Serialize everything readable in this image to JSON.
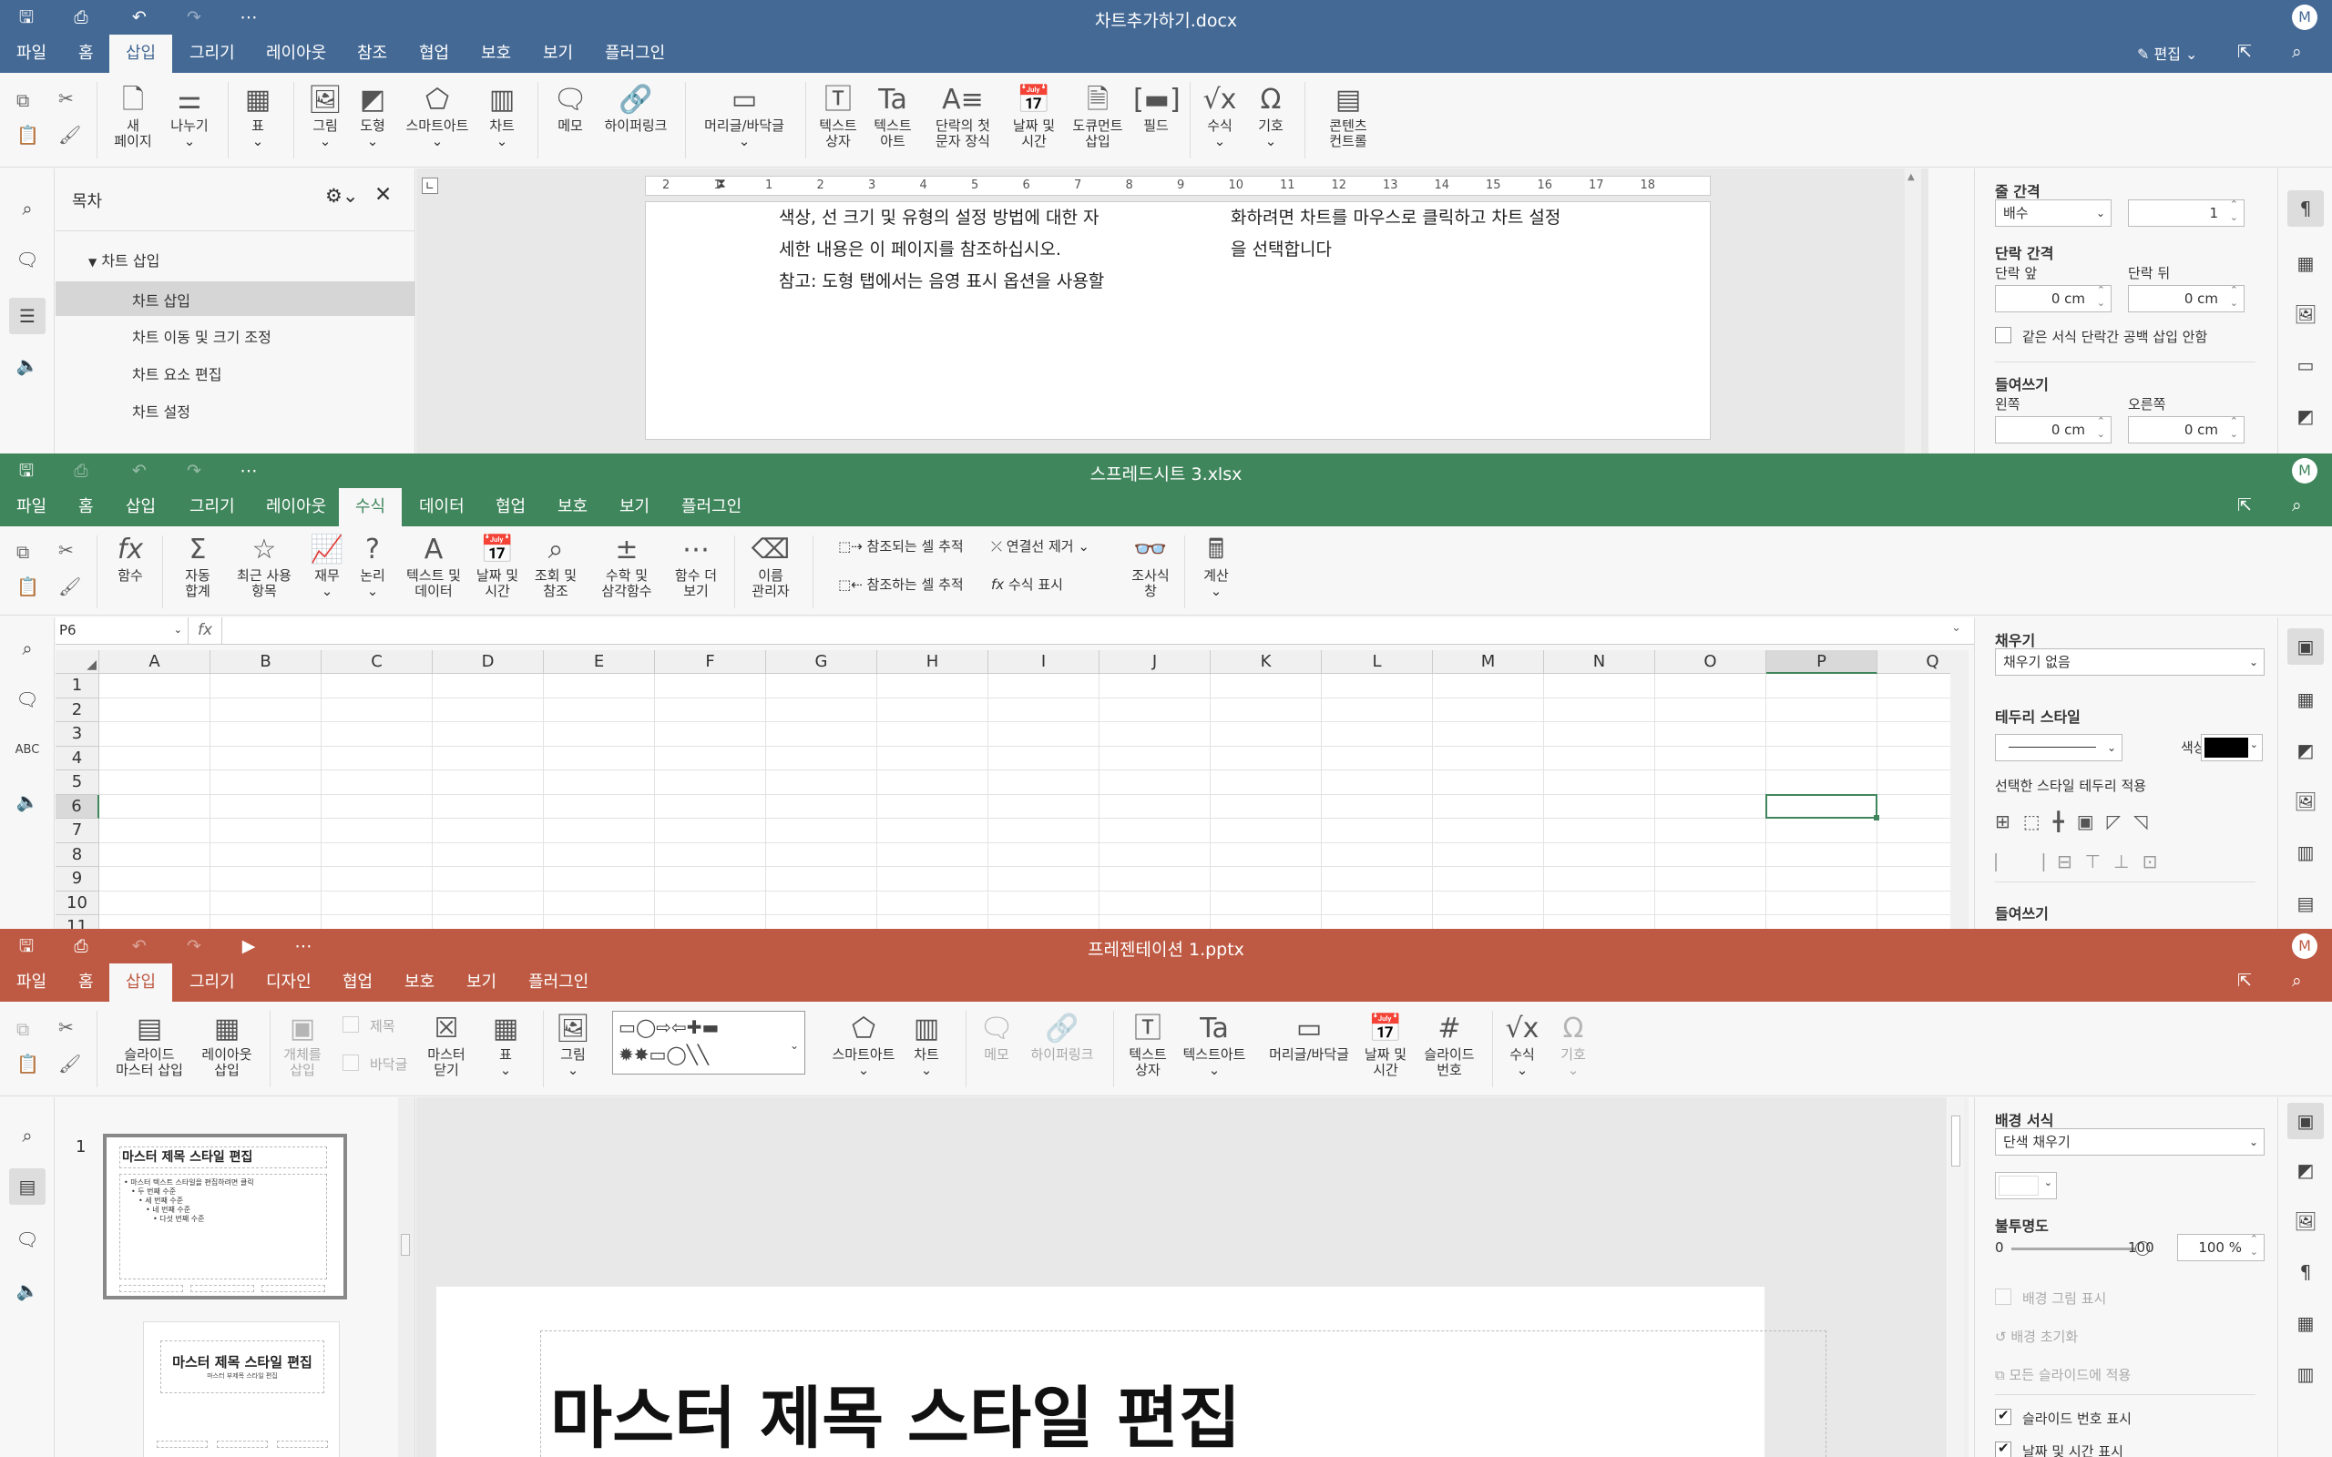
{
  "doc": {
    "title": "차트추가하기.docx",
    "tabs": [
      "파일",
      "홈",
      "삽입",
      "그리기",
      "레이아웃",
      "참조",
      "협업",
      "보호",
      "보기",
      "플러그인"
    ],
    "active_tab": "삽입",
    "edit_label": "편집",
    "ribbon": {
      "new_page": "새\n페이지",
      "break": "나누기",
      "table": "표",
      "image": "그림",
      "shape": "도형",
      "smartart": "스마트아트",
      "chart": "차트",
      "comment": "메모",
      "hyperlink": "하이퍼링크",
      "header_footer": "머리글/바닥글",
      "textbox": "텍스트\n상자",
      "textart": "텍스트\n아트",
      "dropcap": "단락의 첫\n문자 장식",
      "datetime": "날짜 및\n시간",
      "docpart": "도큐먼트\n삽입",
      "field": "필드",
      "equation": "수식",
      "symbol": "기호",
      "content_controls": "콘텐츠\n컨트롤"
    },
    "toc": {
      "title": "목차",
      "items": [
        "차트 삽입",
        "차트 삽입",
        "차트 이동 및 크기 조정",
        "차트 요소 편집",
        "차트 설정"
      ]
    },
    "ruler": [
      "2",
      "1",
      "1",
      "2",
      "3",
      "4",
      "5",
      "6",
      "7",
      "8",
      "9",
      "10",
      "11",
      "12",
      "13",
      "14",
      "15",
      "16",
      "17",
      "18"
    ],
    "text_left": [
      "색상, 선 크기 및 유형의 설정 방법에 대한 자",
      "세한 내용은 이 페이지를 참조하십시오.",
      "참고: 도형 탭에서는 음영 표시 옵션을 사용할"
    ],
    "text_right": [
      "화하려면 차트를 마우스로 클릭하고 차트 설정",
      "을 선택합니다"
    ],
    "props": {
      "line_spacing": "줄 간격",
      "line_mode": "배수",
      "line_val": "1",
      "para_spacing": "단락 간격",
      "before": "단락 앞",
      "after": "단락 뒤",
      "before_val": "0 cm",
      "after_val": "0 cm",
      "no_space": "같은 서식 단락간 공백 삽입 안함",
      "indent": "들여쓰기",
      "left": "왼쪽",
      "right": "오른쪽",
      "left_val": "0 cm",
      "right_val": "0 cm"
    }
  },
  "sheet": {
    "title": "스프레드시트 3.xlsx",
    "tabs": [
      "파일",
      "홈",
      "삽입",
      "그리기",
      "레이아웃",
      "수식",
      "데이터",
      "협업",
      "보호",
      "보기",
      "플러그인"
    ],
    "active_tab": "수식",
    "ribbon": {
      "function": "함수",
      "autosum": "자동\n합계",
      "recent": "최근 사용\n항목",
      "financial": "재무",
      "logical": "논리",
      "text_data": "텍스트 및\n데이터",
      "datetime": "날짜 및\n시간",
      "lookup": "조회 및\n참조",
      "math": "수학 및\n삼각함수",
      "more": "함수 더\n보기",
      "names": "이름\n관리자",
      "trace_prec": "참조되는 셀 추적",
      "trace_dep": "참조하는 셀 추적",
      "remove_arrows": "연결선 제거",
      "show_formula": "수식 표시",
      "watch": "조사식\n창",
      "calc": "계산"
    },
    "name_box": "P6",
    "fx": "fx",
    "columns": [
      "A",
      "B",
      "C",
      "D",
      "E",
      "F",
      "G",
      "H",
      "I",
      "J",
      "K",
      "L",
      "M",
      "N",
      "O",
      "P",
      "Q"
    ],
    "rows": [
      "1",
      "2",
      "3",
      "4",
      "5",
      "6",
      "7",
      "8",
      "9",
      "10",
      "11"
    ],
    "props": {
      "fill": "채우기",
      "fill_val": "채우기 없음",
      "border_style": "테두리 스타일",
      "color": "색상",
      "apply": "선택한 스타일 테두리 적용",
      "indent": "들여쓰기"
    }
  },
  "pres": {
    "title": "프레젠테이션 1.pptx",
    "tabs": [
      "파일",
      "홈",
      "삽입",
      "그리기",
      "디자인",
      "협업",
      "보호",
      "보기",
      "플러그인"
    ],
    "active_tab": "삽입",
    "ribbon": {
      "slide_master": "슬라이드\n마스터 삽입",
      "layout": "레이아웃\n삽입",
      "object": "개체를\n삽입",
      "title": "제목",
      "footer": "바닥글",
      "close_master": "마스터\n닫기",
      "table": "표",
      "image": "그림",
      "smartart": "스마트아트",
      "chart": "차트",
      "comment": "메모",
      "hyperlink": "하이퍼링크",
      "textbox": "텍스트\n상자",
      "textart": "텍스트아트",
      "header_footer": "머리글/바닥글",
      "datetime": "날짜 및\n시간",
      "slide_num": "슬라이드\n번호",
      "equation": "수식",
      "symbol": "기호"
    },
    "slide_index": "1",
    "thumb1_title": "마스터 제목 스타일 편집",
    "thumb1_lines": [
      "• 마스터 텍스트 스타일을 편집하려면 클릭",
      "• 두 번째 수준",
      "• 세 번째 수준",
      "• 네 번째 수준",
      "• 다섯 번째 수준"
    ],
    "thumb2_title": "마스터 제목 스타일 편집",
    "thumb2_sub": "마스터 부제목 스타일 편집",
    "slide_title": "마스터 제목 스타일 편집",
    "props": {
      "bg": "배경 서식",
      "bg_val": "단색 채우기",
      "opacity": "불투명도",
      "op_min": "0",
      "op_max": "100",
      "op_val": "100 %",
      "show_bg": "배경 그림 표시",
      "reset": "배경 초기화",
      "apply_all": "모든 슬라이드에 적용",
      "show_num": "슬라이드 번호 표시",
      "show_date": "날짜 및 시간 표시"
    }
  }
}
